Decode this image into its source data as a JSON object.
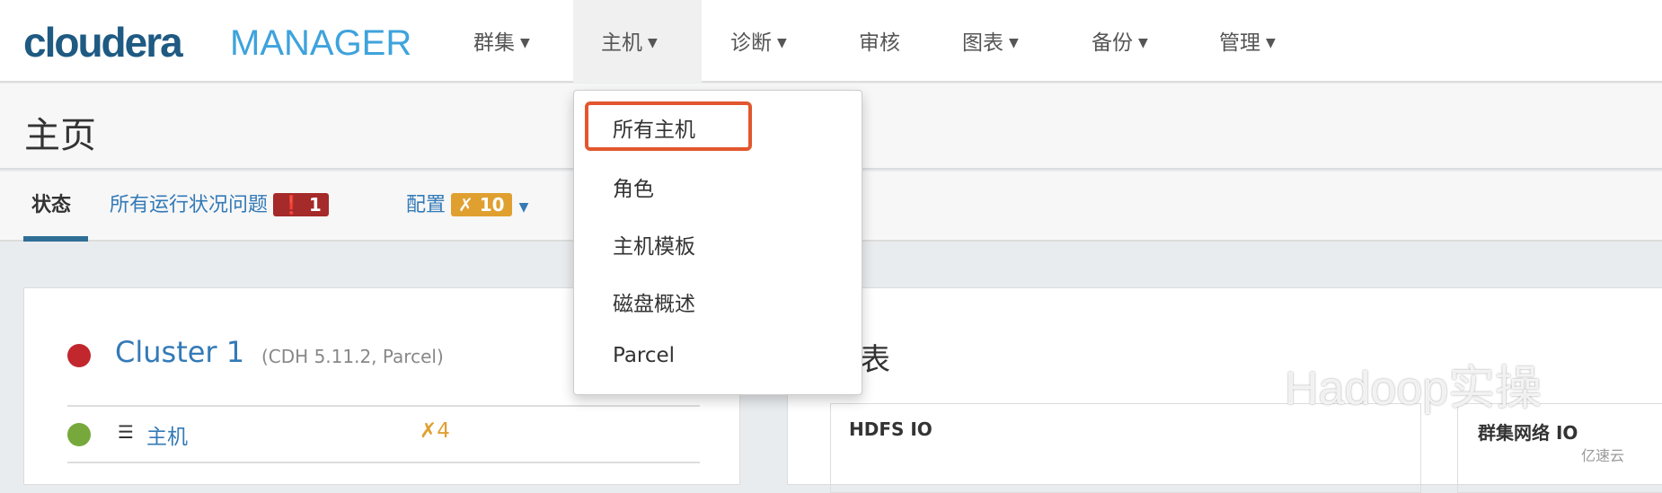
{
  "header": {
    "logo_main": "cloudera",
    "logo_sub": "MANAGER",
    "nav": [
      {
        "label": "群集",
        "dropdown": true
      },
      {
        "label": "主机",
        "dropdown": true,
        "active": true
      },
      {
        "label": "诊断",
        "dropdown": true
      },
      {
        "label": "审核",
        "dropdown": false
      },
      {
        "label": "图表",
        "dropdown": true
      },
      {
        "label": "备份",
        "dropdown": true
      },
      {
        "label": "管理",
        "dropdown": true
      }
    ]
  },
  "page": {
    "title": "主页"
  },
  "tabs": {
    "status": "状态",
    "health_issues": "所有运行状况问题",
    "health_count": "1",
    "config": "配置",
    "config_count": "10"
  },
  "dropdown": {
    "items": [
      "所有主机",
      "角色",
      "主机模板",
      "磁盘概述",
      "Parcel"
    ],
    "highlighted": "所有主机"
  },
  "cluster": {
    "name": "Cluster 1",
    "meta": "(CDH 5.11.2, Parcel)",
    "status_color": "#c1272d",
    "row": {
      "label": "主机",
      "config_count": "4",
      "status_color": "#76a83c"
    }
  },
  "charts": {
    "heading": "表",
    "panels": [
      "HDFS IO",
      "群集网络 IO"
    ]
  },
  "watermark": {
    "text": "Hadoop实操",
    "corner": "亿速云"
  },
  "colors": {
    "accent": "#337ab7",
    "danger": "#a52a2a",
    "warning": "#e0a030",
    "highlight": "#e2572e"
  }
}
